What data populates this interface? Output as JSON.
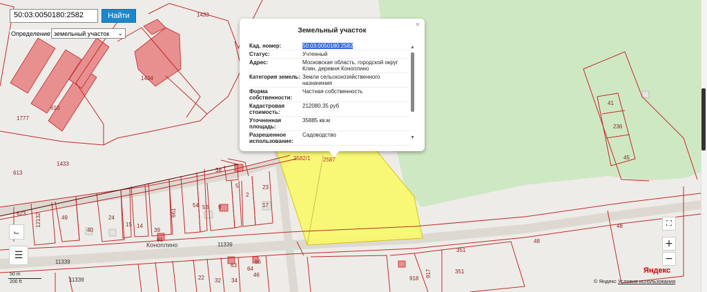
{
  "search": {
    "value": "50:03:0050180:2582",
    "button_label": "Найти"
  },
  "definition": {
    "label": "Определение:",
    "selected": "земельный участок"
  },
  "popup": {
    "title": "Земельный участок",
    "close_symbol": "×",
    "rows": [
      {
        "key": "Кад. номер:",
        "value": "50:03:0050180:2582"
      },
      {
        "key": "Статус:",
        "value": "Учтенный"
      },
      {
        "key": "Адрес:",
        "value": "Московская область, городской округ Клин, деревня Коноплино"
      },
      {
        "key": "Категория земель:",
        "value": "Земли сельскохозяйственного назначения"
      },
      {
        "key": "Форма собственности:",
        "value": "Частная собственность"
      },
      {
        "key": "Кадастровая стоимость:",
        "value": "212080.35 руб"
      },
      {
        "key": "Уточненная площадь:",
        "value": "35885 кв.м"
      },
      {
        "key": "Разрешенное использование:",
        "value": "Садоводство"
      }
    ]
  },
  "map": {
    "parcel_labels": [
      "1433",
      "1434",
      "610",
      "1777",
      "613",
      "1433",
      "623",
      "12132",
      "49",
      "40",
      "24",
      "15",
      "14",
      "39",
      "81",
      "661",
      "54",
      "53",
      "9",
      "5",
      "2",
      "17",
      "23",
      "38",
      "41",
      "236",
      "45",
      "48",
      "48",
      "351",
      "351",
      "918",
      "917",
      "46",
      "34",
      "32",
      "22",
      "63",
      "64",
      "66",
      "2582/1",
      "2587"
    ],
    "town_label": "Коноплино",
    "street_labels": [
      "11339",
      "11339",
      "11339"
    ],
    "colors": {
      "road": "#d9d5cf",
      "forest": "#cfe8c4",
      "parcel_line": "#c02a2a",
      "building": "#e88f8f",
      "selected_parcel": "#fbf96a"
    }
  },
  "controls": {
    "fullscreen": "⛶",
    "zoom_in": "+",
    "zoom_out": "−",
    "ruler": "⌙",
    "layers": "☰"
  },
  "scale": {
    "top": "50 m",
    "bottom": "200 ft"
  },
  "attribution": {
    "logo": "Яндекс",
    "copyright": "© Яндекс",
    "terms": "Условия использования"
  }
}
